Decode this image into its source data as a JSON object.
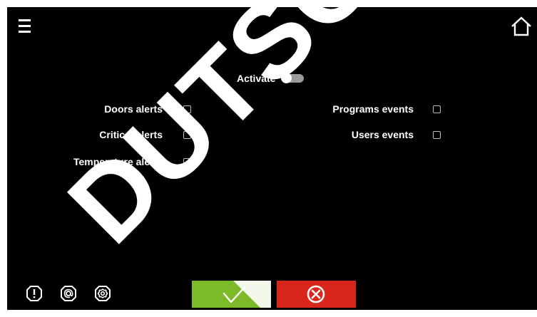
{
  "header": {
    "menu_icon": "hamburger-menu-icon",
    "home_icon": "home-icon"
  },
  "activate": {
    "label": "Activate",
    "state": "off"
  },
  "alerts": {
    "left": [
      {
        "label": "Doors alerts",
        "checked": false
      },
      {
        "label": "Critical alerts",
        "checked": false
      },
      {
        "label": "Temperature alerts",
        "checked": false
      }
    ],
    "right": [
      {
        "label": "Programs events",
        "checked": false
      },
      {
        "label": "Users events",
        "checked": false
      }
    ]
  },
  "footer": {
    "icons": [
      "alert-icon",
      "email-icon",
      "settings-icon"
    ]
  },
  "buttons": {
    "confirm_icon": "checkmark-icon",
    "cancel_icon": "close-circle-icon",
    "confirm_color": "#7cba2a",
    "cancel_color": "#d9261c"
  },
  "watermark": {
    "text": "DUTSCHER"
  }
}
